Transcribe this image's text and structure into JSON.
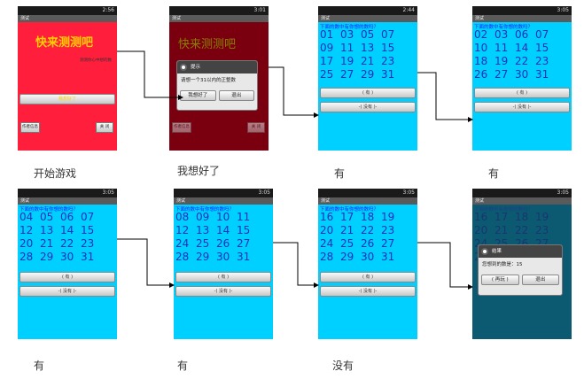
{
  "status_time": {
    "p1": "2:56",
    "p2": "3:01",
    "p3": "2:44",
    "p4": "3:05",
    "p5": "3:05",
    "p6": "3:05",
    "p7": "3:05",
    "p8": "3:05"
  },
  "title_bar": "测试",
  "start_screen": {
    "heading": "快来测测吧",
    "subtitle": "测测你心中想的数",
    "btn_bar": "我想好了",
    "btn_left": "作者信息",
    "btn_right": "关 闭"
  },
  "prompt_dialog": {
    "title": "提示",
    "body": "请想一个31以内的正整数",
    "ok": "我想好了",
    "exit": "退出"
  },
  "question": "下面的数中有你想的数吗？",
  "yes_label": "( 有 )",
  "no_label": "-( 没有 )-",
  "grids": {
    "g3": [
      "01",
      "03",
      "05",
      "07",
      "09",
      "11",
      "13",
      "15",
      "17",
      "19",
      "21",
      "23",
      "25",
      "27",
      "29",
      "31"
    ],
    "g4": [
      "02",
      "03",
      "06",
      "07",
      "10",
      "11",
      "14",
      "15",
      "18",
      "19",
      "22",
      "23",
      "26",
      "27",
      "30",
      "31"
    ],
    "g5": [
      "04",
      "05",
      "06",
      "07",
      "12",
      "13",
      "14",
      "15",
      "20",
      "21",
      "22",
      "23",
      "28",
      "29",
      "30",
      "31"
    ],
    "g6": [
      "08",
      "09",
      "10",
      "11",
      "12",
      "13",
      "14",
      "15",
      "24",
      "25",
      "26",
      "27",
      "28",
      "29",
      "30",
      "31"
    ],
    "g7": [
      "16",
      "17",
      "18",
      "19",
      "20",
      "21",
      "22",
      "23",
      "24",
      "25",
      "26",
      "27",
      "28",
      "29",
      "30",
      "31"
    ]
  },
  "result_dialog": {
    "title": "结果",
    "body": "您想到的数是：15",
    "again": "( 再玩 )",
    "exit": "退出"
  },
  "captions": {
    "c1": "开始游戏",
    "c2": "我想好了",
    "c3": "有",
    "c4": "有",
    "c5": "有",
    "c6": "有",
    "c7": "没有"
  },
  "colors": {
    "cyan": "#00d0ff",
    "red": "#ff1e3c",
    "dark_red": "#7a0010",
    "dark_teal": "#0b5a72"
  }
}
